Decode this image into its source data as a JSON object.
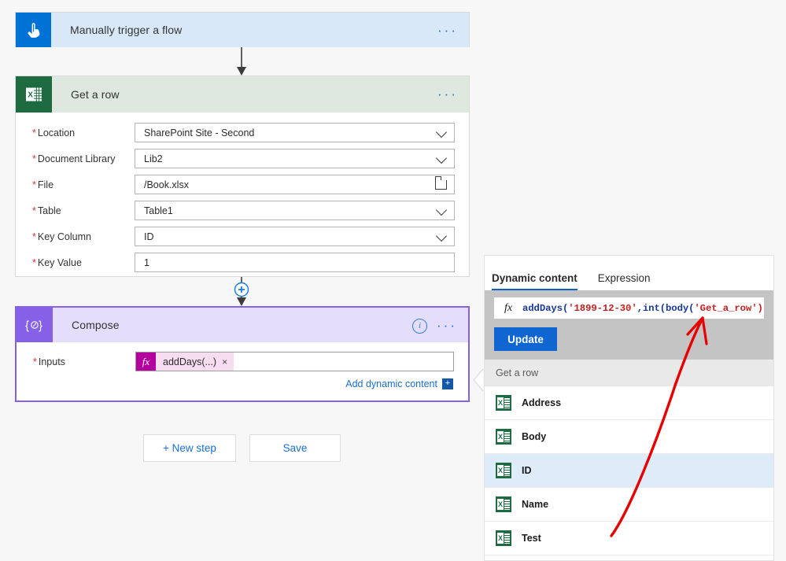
{
  "trigger_card": {
    "icon": "tap-hand-icon",
    "title": "Manually trigger a flow",
    "menu": "···"
  },
  "getrow_card": {
    "icon": "excel-icon",
    "title": "Get a row",
    "menu": "···",
    "fields": [
      {
        "label": "Location",
        "required": true,
        "value": "SharePoint Site - Second",
        "control": "dropdown"
      },
      {
        "label": "Document Library",
        "required": true,
        "value": "Lib2",
        "control": "dropdown"
      },
      {
        "label": "File",
        "required": true,
        "value": "/Book.xlsx",
        "control": "file-picker"
      },
      {
        "label": "Table",
        "required": true,
        "value": "Table1",
        "control": "dropdown"
      },
      {
        "label": "Key Column",
        "required": true,
        "value": "ID",
        "control": "dropdown"
      },
      {
        "label": "Key Value",
        "required": true,
        "value": "1",
        "control": "text"
      }
    ]
  },
  "compose_card": {
    "icon": "compose-braces-icon",
    "title": "Compose",
    "info": "i",
    "menu": "···",
    "inputs_label": "Inputs",
    "inputs_required": true,
    "token_fx": "fx",
    "token_label": "addDays(...)",
    "token_remove": "×",
    "add_dynamic_content": "Add dynamic content",
    "add_dynamic_plus": "+"
  },
  "actions": {
    "new_step": "+ New step",
    "save": "Save"
  },
  "dynamic_panel": {
    "tabs": [
      {
        "label": "Dynamic content",
        "active": true
      },
      {
        "label": "Expression",
        "active": false
      }
    ],
    "expression": {
      "fx": "fx",
      "parts": [
        {
          "text": "addDays(",
          "kind": "fn"
        },
        {
          "text": "'1899-12-30'",
          "kind": "str"
        },
        {
          "text": ",int(body(",
          "kind": "fn"
        },
        {
          "text": "'Get_a_row')",
          "kind": "str"
        }
      ],
      "full_text": "addDays('1899-12-30',int(body('Get_a_row')",
      "update_button": "Update"
    },
    "group_header": "Get a row",
    "items": [
      {
        "label": "Address",
        "icon": "excel-icon",
        "selected": false
      },
      {
        "label": "Body",
        "icon": "excel-icon",
        "selected": false
      },
      {
        "label": "ID",
        "icon": "excel-icon",
        "selected": true
      },
      {
        "label": "Name",
        "icon": "excel-icon",
        "selected": false
      },
      {
        "label": "Test",
        "icon": "excel-icon",
        "selected": false
      }
    ]
  },
  "annotation": {
    "type": "red-arrow",
    "color": "#e60000",
    "points_to": "'Get_a_row')"
  },
  "colors": {
    "trigger_header": "#d8e8f9",
    "trigger_icon": "#0072d6",
    "excel_header": "#dee8de",
    "excel_icon": "#1e6b41",
    "compose_header": "#e4ddfb",
    "compose_border": "#8661e8",
    "accent_link": "#1a6fd4",
    "update_button": "#0f66d0",
    "selected_item": "#deecfa",
    "required_mark": "#d13438",
    "annotation_red": "#e60000"
  }
}
